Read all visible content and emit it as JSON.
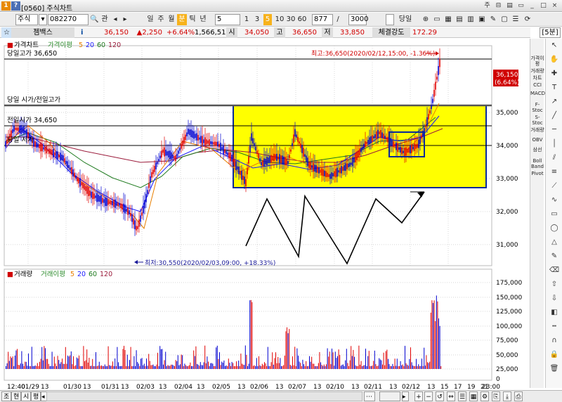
{
  "window": {
    "title": "[0560] 주식차트"
  },
  "toolbar": {
    "market": "주식",
    "code": "082270",
    "kwan": "관",
    "periods": [
      "일",
      "주",
      "월",
      "분",
      "틱",
      "년"
    ],
    "selected_period": "분",
    "interval_value": "5",
    "minute_options": [
      "1",
      "3",
      "5",
      "10",
      "30",
      "60"
    ],
    "selected_minute": "5",
    "count": "877",
    "total": "3000",
    "today_label": "당일"
  },
  "infobar": {
    "name": "젬백스",
    "price": "36,150",
    "change": "▲2,250",
    "change_pct": "+6.64%",
    "volume": "1,566,514",
    "open_label": "시",
    "open": "34,050",
    "high_label": "고",
    "high": "36,650",
    "low_label": "저",
    "low": "33,850",
    "strength_label": "체결강도",
    "strength": "172.29",
    "timeframe": "[5분]"
  },
  "price_chart": {
    "legend": {
      "price": "가격차트",
      "ma": "가격이평",
      "ma_periods": [
        "5",
        "20",
        "60",
        "120"
      ]
    },
    "ref_lines": [
      {
        "label": "당일고가 36,650",
        "value": 36650
      },
      {
        "label": "당일 시가/전일고가",
        "value": 35250
      },
      {
        "label": "전일시가 34,650",
        "value": 34650
      },
      {
        "label": "당일 저가",
        "value": 34050
      }
    ],
    "annotation_high": "최고:36,650(2020/02/12,15:00, -1.36%)",
    "annotation_low": "최저:30,550(2020/02/03,09:00, +18.33%)",
    "current_price": "36,150",
    "current_pct": "(6.64%)",
    "y_ticks": [
      "35,000",
      "34,000",
      "33,000",
      "32,000",
      "31,000"
    ]
  },
  "volume_chart": {
    "legend": {
      "vol": "거래량",
      "ma": "거래이평",
      "ma_periods": [
        "5",
        "20",
        "60",
        "120"
      ]
    },
    "y_ticks": [
      "175,000",
      "150,000",
      "125,000",
      "100,000",
      "75,000",
      "50,000",
      "25,000",
      "0"
    ]
  },
  "x_axis": {
    "labels": [
      "12:40",
      "01/29",
      "13",
      "01/30",
      "13",
      "01/31",
      "13",
      "02/03",
      "13",
      "02/04",
      "13",
      "02/05",
      "13",
      "02/06",
      "13",
      "02/07",
      "13",
      "02/10",
      "13",
      "02/11",
      "13",
      "02/12",
      "13",
      "15",
      "17",
      "19",
      "21",
      "23:00"
    ]
  },
  "sidebar": {
    "items": [
      "가격이평",
      "거래량",
      "차트",
      "CCI",
      "MACD",
      "F-Stoc",
      "S-Stoc",
      "거래량",
      "OBV",
      "삼선",
      "Boll Band",
      "Pivot"
    ]
  },
  "statusbar": {
    "tabs": [
      "조",
      "현",
      "시",
      "평"
    ]
  },
  "colors": {
    "highlight": "#ffff00",
    "box": "#0a2a9a",
    "up": "#e00000",
    "down": "#0000d0"
  }
}
